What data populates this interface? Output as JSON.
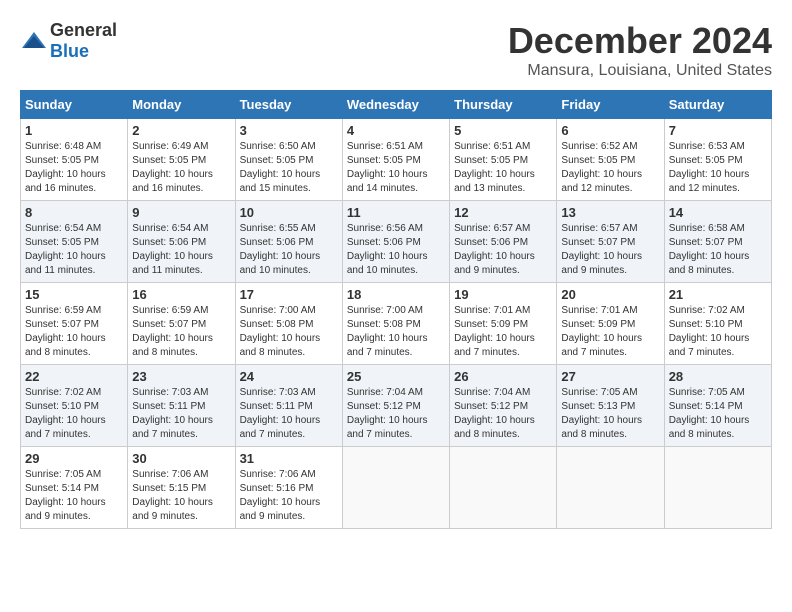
{
  "logo": {
    "text_general": "General",
    "text_blue": "Blue"
  },
  "title": "December 2024",
  "location": "Mansura, Louisiana, United States",
  "days_of_week": [
    "Sunday",
    "Monday",
    "Tuesday",
    "Wednesday",
    "Thursday",
    "Friday",
    "Saturday"
  ],
  "weeks": [
    [
      {
        "day": "1",
        "sunrise": "Sunrise: 6:48 AM",
        "sunset": "Sunset: 5:05 PM",
        "daylight": "Daylight: 10 hours and 16 minutes."
      },
      {
        "day": "2",
        "sunrise": "Sunrise: 6:49 AM",
        "sunset": "Sunset: 5:05 PM",
        "daylight": "Daylight: 10 hours and 16 minutes."
      },
      {
        "day": "3",
        "sunrise": "Sunrise: 6:50 AM",
        "sunset": "Sunset: 5:05 PM",
        "daylight": "Daylight: 10 hours and 15 minutes."
      },
      {
        "day": "4",
        "sunrise": "Sunrise: 6:51 AM",
        "sunset": "Sunset: 5:05 PM",
        "daylight": "Daylight: 10 hours and 14 minutes."
      },
      {
        "day": "5",
        "sunrise": "Sunrise: 6:51 AM",
        "sunset": "Sunset: 5:05 PM",
        "daylight": "Daylight: 10 hours and 13 minutes."
      },
      {
        "day": "6",
        "sunrise": "Sunrise: 6:52 AM",
        "sunset": "Sunset: 5:05 PM",
        "daylight": "Daylight: 10 hours and 12 minutes."
      },
      {
        "day": "7",
        "sunrise": "Sunrise: 6:53 AM",
        "sunset": "Sunset: 5:05 PM",
        "daylight": "Daylight: 10 hours and 12 minutes."
      }
    ],
    [
      {
        "day": "8",
        "sunrise": "Sunrise: 6:54 AM",
        "sunset": "Sunset: 5:05 PM",
        "daylight": "Daylight: 10 hours and 11 minutes."
      },
      {
        "day": "9",
        "sunrise": "Sunrise: 6:54 AM",
        "sunset": "Sunset: 5:06 PM",
        "daylight": "Daylight: 10 hours and 11 minutes."
      },
      {
        "day": "10",
        "sunrise": "Sunrise: 6:55 AM",
        "sunset": "Sunset: 5:06 PM",
        "daylight": "Daylight: 10 hours and 10 minutes."
      },
      {
        "day": "11",
        "sunrise": "Sunrise: 6:56 AM",
        "sunset": "Sunset: 5:06 PM",
        "daylight": "Daylight: 10 hours and 10 minutes."
      },
      {
        "day": "12",
        "sunrise": "Sunrise: 6:57 AM",
        "sunset": "Sunset: 5:06 PM",
        "daylight": "Daylight: 10 hours and 9 minutes."
      },
      {
        "day": "13",
        "sunrise": "Sunrise: 6:57 AM",
        "sunset": "Sunset: 5:07 PM",
        "daylight": "Daylight: 10 hours and 9 minutes."
      },
      {
        "day": "14",
        "sunrise": "Sunrise: 6:58 AM",
        "sunset": "Sunset: 5:07 PM",
        "daylight": "Daylight: 10 hours and 8 minutes."
      }
    ],
    [
      {
        "day": "15",
        "sunrise": "Sunrise: 6:59 AM",
        "sunset": "Sunset: 5:07 PM",
        "daylight": "Daylight: 10 hours and 8 minutes."
      },
      {
        "day": "16",
        "sunrise": "Sunrise: 6:59 AM",
        "sunset": "Sunset: 5:07 PM",
        "daylight": "Daylight: 10 hours and 8 minutes."
      },
      {
        "day": "17",
        "sunrise": "Sunrise: 7:00 AM",
        "sunset": "Sunset: 5:08 PM",
        "daylight": "Daylight: 10 hours and 8 minutes."
      },
      {
        "day": "18",
        "sunrise": "Sunrise: 7:00 AM",
        "sunset": "Sunset: 5:08 PM",
        "daylight": "Daylight: 10 hours and 7 minutes."
      },
      {
        "day": "19",
        "sunrise": "Sunrise: 7:01 AM",
        "sunset": "Sunset: 5:09 PM",
        "daylight": "Daylight: 10 hours and 7 minutes."
      },
      {
        "day": "20",
        "sunrise": "Sunrise: 7:01 AM",
        "sunset": "Sunset: 5:09 PM",
        "daylight": "Daylight: 10 hours and 7 minutes."
      },
      {
        "day": "21",
        "sunrise": "Sunrise: 7:02 AM",
        "sunset": "Sunset: 5:10 PM",
        "daylight": "Daylight: 10 hours and 7 minutes."
      }
    ],
    [
      {
        "day": "22",
        "sunrise": "Sunrise: 7:02 AM",
        "sunset": "Sunset: 5:10 PM",
        "daylight": "Daylight: 10 hours and 7 minutes."
      },
      {
        "day": "23",
        "sunrise": "Sunrise: 7:03 AM",
        "sunset": "Sunset: 5:11 PM",
        "daylight": "Daylight: 10 hours and 7 minutes."
      },
      {
        "day": "24",
        "sunrise": "Sunrise: 7:03 AM",
        "sunset": "Sunset: 5:11 PM",
        "daylight": "Daylight: 10 hours and 7 minutes."
      },
      {
        "day": "25",
        "sunrise": "Sunrise: 7:04 AM",
        "sunset": "Sunset: 5:12 PM",
        "daylight": "Daylight: 10 hours and 7 minutes."
      },
      {
        "day": "26",
        "sunrise": "Sunrise: 7:04 AM",
        "sunset": "Sunset: 5:12 PM",
        "daylight": "Daylight: 10 hours and 8 minutes."
      },
      {
        "day": "27",
        "sunrise": "Sunrise: 7:05 AM",
        "sunset": "Sunset: 5:13 PM",
        "daylight": "Daylight: 10 hours and 8 minutes."
      },
      {
        "day": "28",
        "sunrise": "Sunrise: 7:05 AM",
        "sunset": "Sunset: 5:14 PM",
        "daylight": "Daylight: 10 hours and 8 minutes."
      }
    ],
    [
      {
        "day": "29",
        "sunrise": "Sunrise: 7:05 AM",
        "sunset": "Sunset: 5:14 PM",
        "daylight": "Daylight: 10 hours and 9 minutes."
      },
      {
        "day": "30",
        "sunrise": "Sunrise: 7:06 AM",
        "sunset": "Sunset: 5:15 PM",
        "daylight": "Daylight: 10 hours and 9 minutes."
      },
      {
        "day": "31",
        "sunrise": "Sunrise: 7:06 AM",
        "sunset": "Sunset: 5:16 PM",
        "daylight": "Daylight: 10 hours and 9 minutes."
      },
      null,
      null,
      null,
      null
    ]
  ]
}
